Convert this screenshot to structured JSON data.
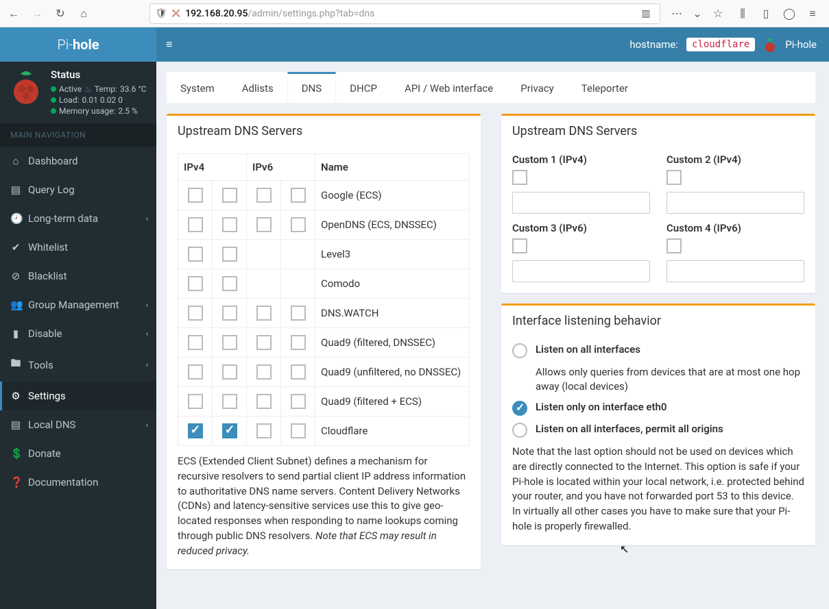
{
  "browser": {
    "url_host": "192.168.20.95",
    "url_path": "/admin/settings.php?tab=dns"
  },
  "topbar": {
    "logo_pre": "Pi-",
    "logo_bold": "hole",
    "hostname_label": "hostname:",
    "hostname_value": "cloudflare",
    "brand_text": "Pi-hole"
  },
  "status": {
    "title": "Status",
    "active": "Active",
    "temp_label": "Temp:",
    "temp_value": "33.6 °C",
    "load_label": "Load:",
    "load_value": "0.01  0.02  0",
    "mem_label": "Memory usage:",
    "mem_value": "2.5 %"
  },
  "nav": {
    "header": "MAIN NAVIGATION",
    "items": [
      {
        "label": "Dashboard",
        "icon": "⌂",
        "expandable": false
      },
      {
        "label": "Query Log",
        "icon": "▤",
        "expandable": false
      },
      {
        "label": "Long-term data",
        "icon": "🕘",
        "expandable": true
      },
      {
        "label": "Whitelist",
        "icon": "✔",
        "expandable": false
      },
      {
        "label": "Blacklist",
        "icon": "⊘",
        "expandable": false
      },
      {
        "label": "Group Management",
        "icon": "👥",
        "expandable": true
      },
      {
        "label": "Disable",
        "icon": "▮",
        "expandable": true
      },
      {
        "label": "Tools",
        "icon": "🖿",
        "expandable": true
      },
      {
        "label": "Settings",
        "icon": "⚙",
        "expandable": false,
        "active": true
      },
      {
        "label": "Local DNS",
        "icon": "▤",
        "expandable": true
      },
      {
        "label": "Donate",
        "icon": "💲",
        "expandable": false
      },
      {
        "label": "Documentation",
        "icon": "❓",
        "expandable": false
      }
    ]
  },
  "tabs": [
    "System",
    "Adlists",
    "DNS",
    "DHCP",
    "API / Web interface",
    "Privacy",
    "Teleporter"
  ],
  "active_tab": "DNS",
  "upstream": {
    "title": "Upstream DNS Servers",
    "th_ipv4": "IPv4",
    "th_ipv6": "IPv6",
    "th_name": "Name",
    "rows": [
      {
        "name": "Google (ECS)",
        "v4a": false,
        "v4b": false,
        "v6a": false,
        "v6b": false,
        "has_v6": true
      },
      {
        "name": "OpenDNS (ECS, DNSSEC)",
        "v4a": false,
        "v4b": false,
        "v6a": false,
        "v6b": false,
        "has_v6": true
      },
      {
        "name": "Level3",
        "v4a": false,
        "v4b": false,
        "has_v6": false
      },
      {
        "name": "Comodo",
        "v4a": false,
        "v4b": false,
        "has_v6": false
      },
      {
        "name": "DNS.WATCH",
        "v4a": false,
        "v4b": false,
        "v6a": false,
        "v6b": false,
        "has_v6": true
      },
      {
        "name": "Quad9 (filtered, DNSSEC)",
        "v4a": false,
        "v4b": false,
        "v6a": false,
        "v6b": false,
        "has_v6": true
      },
      {
        "name": "Quad9 (unfiltered, no DNSSEC)",
        "v4a": false,
        "v4b": false,
        "v6a": false,
        "v6b": false,
        "has_v6": true
      },
      {
        "name": "Quad9 (filtered + ECS)",
        "v4a": false,
        "v4b": false,
        "v6a": false,
        "v6b": false,
        "has_v6": true
      },
      {
        "name": "Cloudflare",
        "v4a": true,
        "v4b": true,
        "v6a": false,
        "v6b": false,
        "has_v6": true
      }
    ],
    "ecs_note_1": "ECS (Extended Client Subnet) defines a mechanism for recursive resolvers to send partial client IP address information to authoritative DNS name servers. Content Delivery Networks (CDNs) and latency-sensitive services use this to give geo-located responses when responding to name lookups coming through public DNS resolvers. ",
    "ecs_note_2": "Note that ECS may result in reduced privacy."
  },
  "custom": {
    "title": "Upstream DNS Servers",
    "c1": "Custom 1 (IPv4)",
    "c2": "Custom 2 (IPv4)",
    "c3": "Custom 3 (IPv6)",
    "c4": "Custom 4 (IPv6)"
  },
  "listening": {
    "title": "Interface listening behavior",
    "opt1_label": "Listen on all interfaces",
    "opt1_sub": "Allows only queries from devices that are at most one hop away (local devices)",
    "opt2_label": "Listen only on interface eth0",
    "opt3_label": "Listen on all interfaces, permit all origins",
    "selected": 2,
    "note": "Note that the last option should not be used on devices which are directly connected to the Internet. This option is safe if your Pi-hole is located within your local network, i.e. protected behind your router, and you have not forwarded port 53 to this device. In virtually all other cases you have to make sure that your Pi-hole is properly firewalled."
  }
}
